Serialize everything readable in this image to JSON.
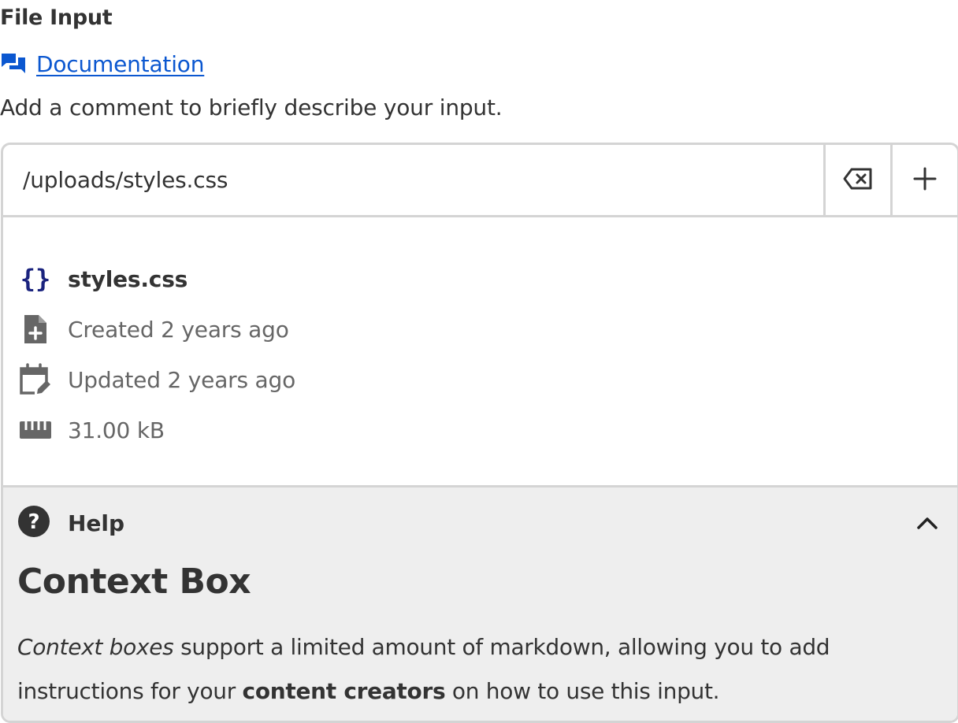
{
  "field": {
    "label": "File Input",
    "documentation_link": "Documentation",
    "comment": "Add a comment to briefly describe your input."
  },
  "input": {
    "value": "/uploads/styles.css",
    "clear_icon": "backspace-icon",
    "add_icon": "plus-icon"
  },
  "file": {
    "name": "styles.css",
    "created": "Created 2 years ago",
    "updated": "Updated 2 years ago",
    "size": "31.00 kB",
    "icons": {
      "type": "curly-braces-icon",
      "created": "file-plus-icon",
      "updated": "calendar-edit-icon",
      "size": "ruler-icon"
    }
  },
  "help": {
    "toggle_label": "Help",
    "heading": "Context Box",
    "body": {
      "italic_lead": "Context boxes",
      "text_1": " support a limited amount of markdown, allowing you to add instructions for your ",
      "bold_phrase": "content creators",
      "text_2": " on how to use this input."
    }
  },
  "colors": {
    "link": "#0b57d0",
    "border": "#d4d4d4",
    "help_background": "#eeeeee",
    "file_type_icon": "#1a237e",
    "text": "#333333",
    "muted_text": "#666666"
  }
}
